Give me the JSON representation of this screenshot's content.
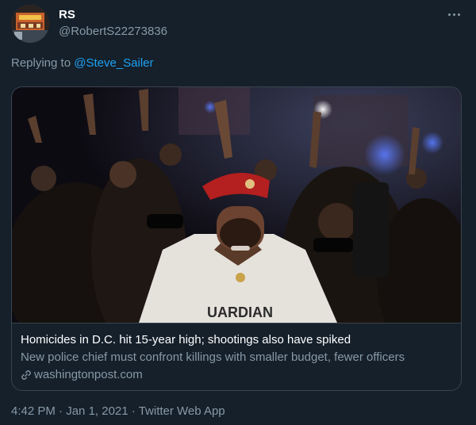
{
  "author": {
    "name": "RS",
    "handle": "@RobertS22273836"
  },
  "reply": {
    "prefix": "Replying to ",
    "mention": "@Steve_Sailer"
  },
  "card": {
    "title": "Homicides in D.C. hit 15-year high; shootings also have spiked",
    "description": "New police chief must confront killings with smaller budget, fewer officers",
    "domain": "washingtonpost.com",
    "shirt_text": "UARDIAN"
  },
  "meta": {
    "time": "4:42 PM",
    "separator": " · ",
    "date": "Jan 1, 2021",
    "app": "Twitter Web App"
  },
  "icons": {
    "more": "more-horizontal-icon",
    "link": "link-icon"
  },
  "colors": {
    "background": "#15202b",
    "primary_text": "#ffffff",
    "secondary_text": "#8899a6",
    "accent": "#1da1f2",
    "border": "#38444d"
  }
}
